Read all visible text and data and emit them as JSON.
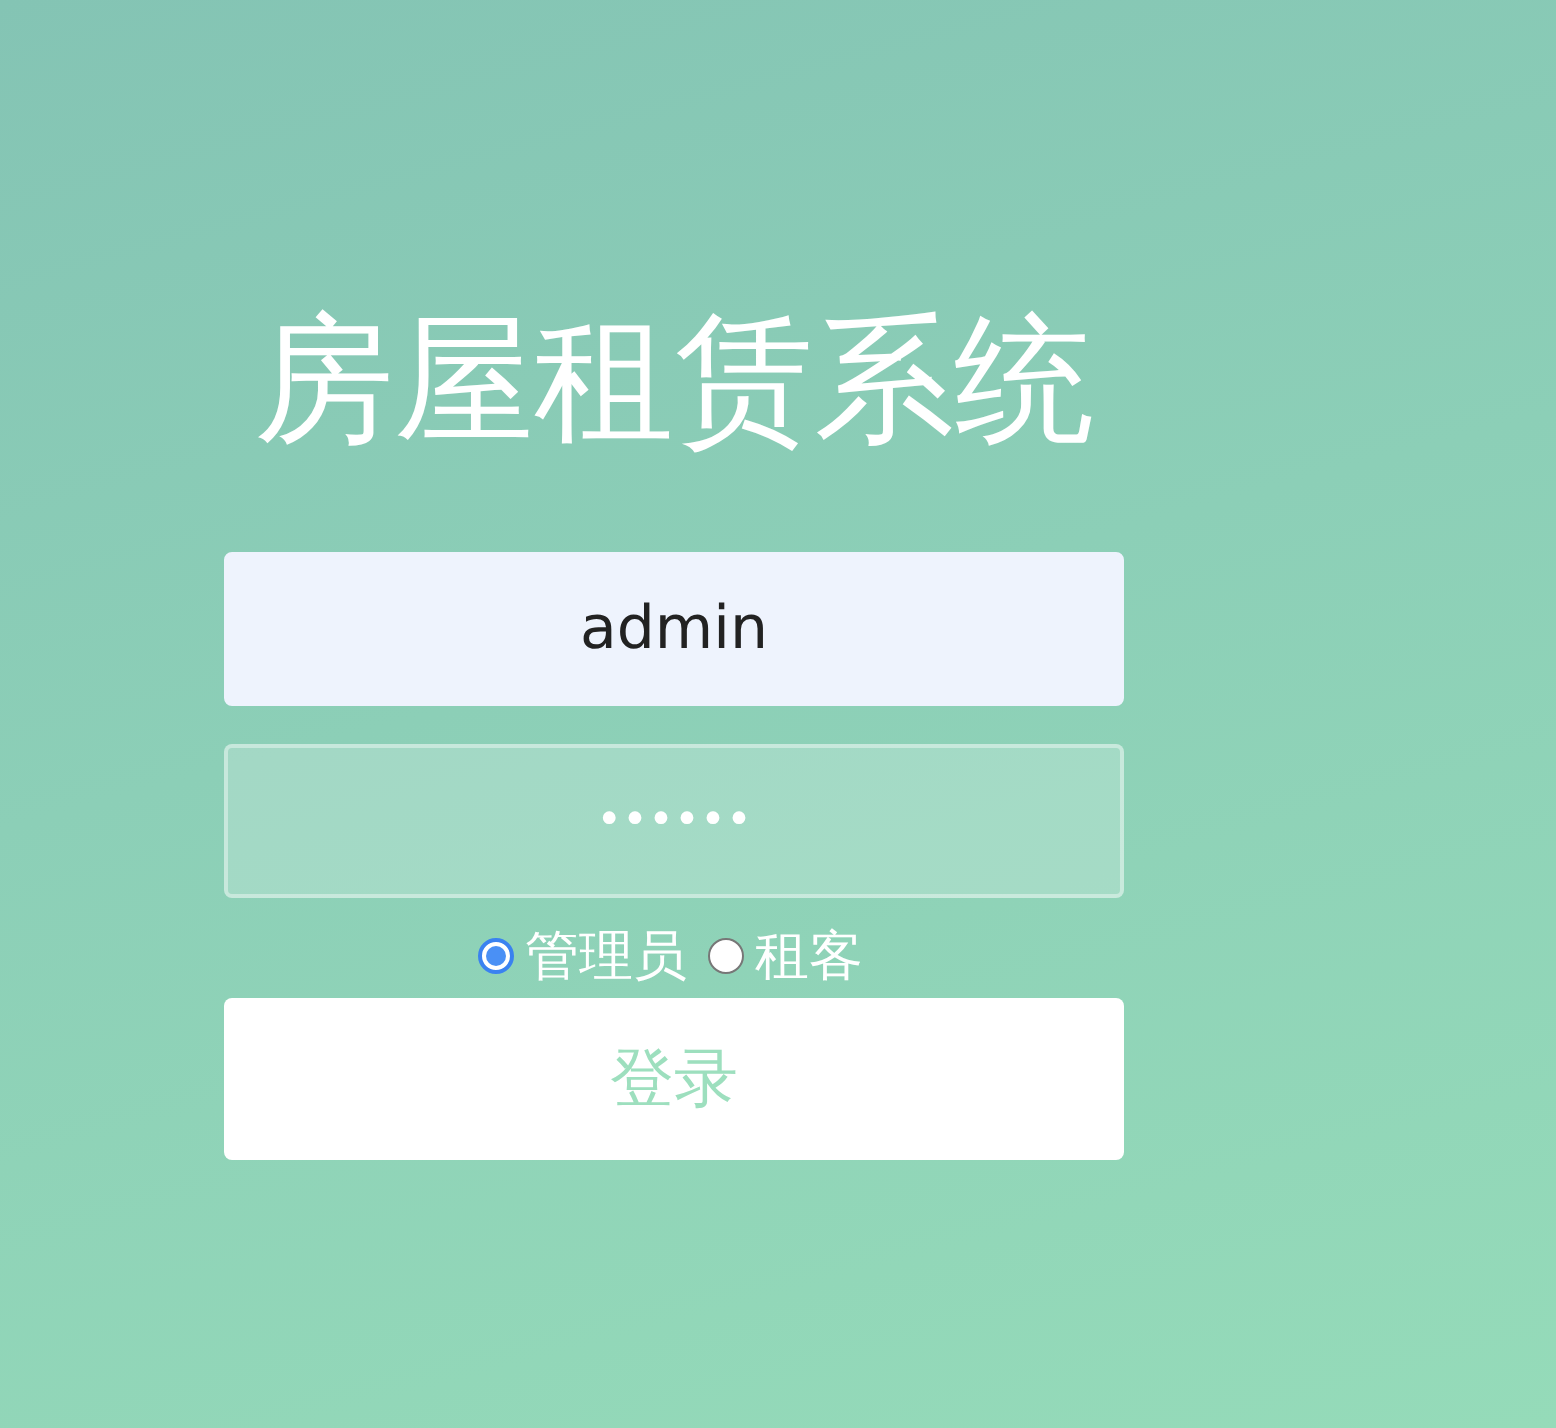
{
  "title": "房屋租赁系统",
  "username": {
    "value": "admin"
  },
  "password": {
    "value": "••••••"
  },
  "roles": [
    {
      "label": "管理员",
      "selected": true
    },
    {
      "label": "租客",
      "selected": false
    }
  ],
  "login_button": {
    "label": "登录"
  }
}
